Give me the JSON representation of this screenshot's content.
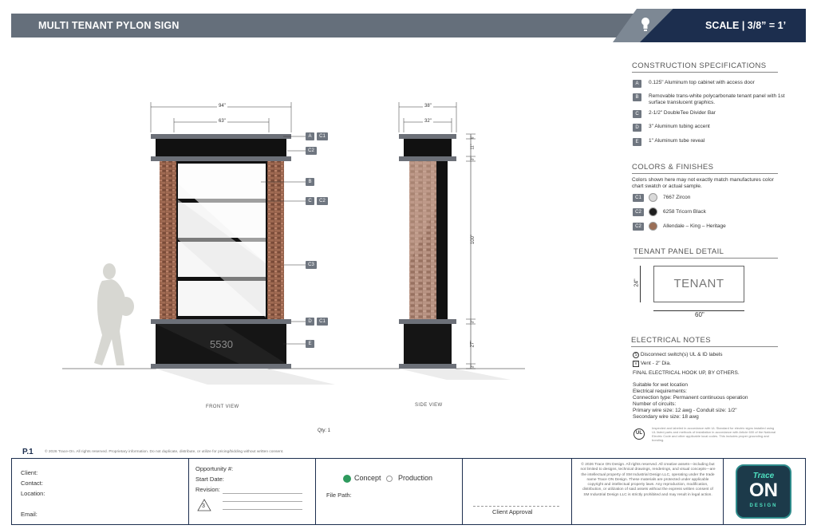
{
  "header": {
    "title": "MULTI TENANT PYLON SIGN",
    "scale": "SCALE | 3/8” = 1’",
    "icon": "lightbulb-icon"
  },
  "construction": {
    "title": "CONSTRUCTION SPECIFICATIONS",
    "items": [
      {
        "letter": "A",
        "text": "0.125\" Aluminum top cabinet with access door"
      },
      {
        "letter": "B",
        "text": "Removable trans-white polycarbonate tenant panel with 1st surface translucent graphics."
      },
      {
        "letter": "C",
        "text": "2-1/2\" DoubleTee Divider Bar"
      },
      {
        "letter": "D",
        "text": "3\" Aluminum tubing accent"
      },
      {
        "letter": "E",
        "text": "1\" Aluminum tube reveal"
      }
    ]
  },
  "colors": {
    "title": "COLORS & FINISHES",
    "note": "Colors shown here may not exactly match manufactures color chart swatch or actual sample.",
    "items": [
      {
        "code": "C1",
        "name": "7667 Zircon",
        "swatch": "#d9d9d9"
      },
      {
        "code": "C2",
        "name": "6258 Tricorn Black",
        "swatch": "#1f1f1f"
      },
      {
        "code": "C2",
        "name": "Allendale – King – Heritage",
        "swatch": "#9b6f57"
      }
    ]
  },
  "tenant_panel": {
    "title": "TENANT PANEL DETAIL",
    "label": "TENANT",
    "height": "24\"",
    "width": "60\""
  },
  "electrical": {
    "title": "ELECTRICAL NOTES",
    "disconnect_symbol": "S",
    "disconnect": "Disconnect switch(s) UL & ID labels",
    "vent_symbol": "V",
    "vent": "Vent - 2\" Dia.",
    "final": "FINAL ELECTRICAL HOOK UP, BY OTHERS.",
    "requirements": [
      "Suitable for wet location",
      "Electrical requirements:",
      "Connection type: Permanent continuous operation",
      "Number of circuits:",
      "Primary wire size: 12 awg - Conduit size: 1/2\"",
      "Secondary wire size: 18 awg"
    ],
    "ul_badge": "UL",
    "ul_text": "Inspected and labeled in accordance with UL Standard for electric signs installed using UL listed parts and methods of installation in accordance with Article 600 of the National Electric Code and other applicable local codes. This includes proper grounding and bonding."
  },
  "front_view": {
    "label": "FRONT VIEW",
    "overall_width": "94\"",
    "cabinet_width": "63\"",
    "address": "5530",
    "callouts": [
      {
        "codes": [
          "A",
          "C1"
        ]
      },
      {
        "codes": [
          "C2"
        ]
      },
      {
        "codes": [
          "B"
        ]
      },
      {
        "codes": [
          "C",
          "C2"
        ]
      },
      {
        "codes": [
          "C3"
        ]
      },
      {
        "codes": [
          "D",
          "C1"
        ]
      },
      {
        "codes": [
          "E"
        ]
      }
    ]
  },
  "side_view": {
    "label": "SIDE VIEW",
    "overall_depth": "38\"",
    "cabinet_depth": "32\"",
    "dims": [
      "6\"",
      "11\"",
      "3\"",
      "100\"",
      "3\"",
      "27\"",
      "3\""
    ]
  },
  "qty": "Qty: 1",
  "footer": {
    "page_logo": "P.1",
    "copyright": "© 2026 Trace-On. All rights reserved. Proprietary information. Do not duplicate, distribute, or utilize for pricing/bidding without written consent.",
    "client_labels": [
      "Client:",
      "Contact:",
      "Location:",
      "Email:"
    ],
    "opportunity": "Opportunity #:",
    "start_date": "Start Date:",
    "revision": "Revision:",
    "revision_number": "3",
    "concept": "Concept",
    "production": "Production",
    "file_path": "File Path:",
    "client_approval": "Client Approval",
    "legal": "© 2026 Trace ON Design. All rights reserved. All creative assets—including but not limited to designs, technical drawings, renderings, and visual concepts—are the intellectual property of SM Industrial Design LLC, operating under the trade name Trace ON Design. These materials are protected under applicable copyright and intellectual property laws. Any reproduction, modification, distribution, or utilization of said assets without the express written consent of SM Industrial Design LLC is strictly prohibited and may result in legal action.",
    "brand_line1": "Trace",
    "brand_line2": "ON",
    "brand_line3": "DESIGN"
  }
}
